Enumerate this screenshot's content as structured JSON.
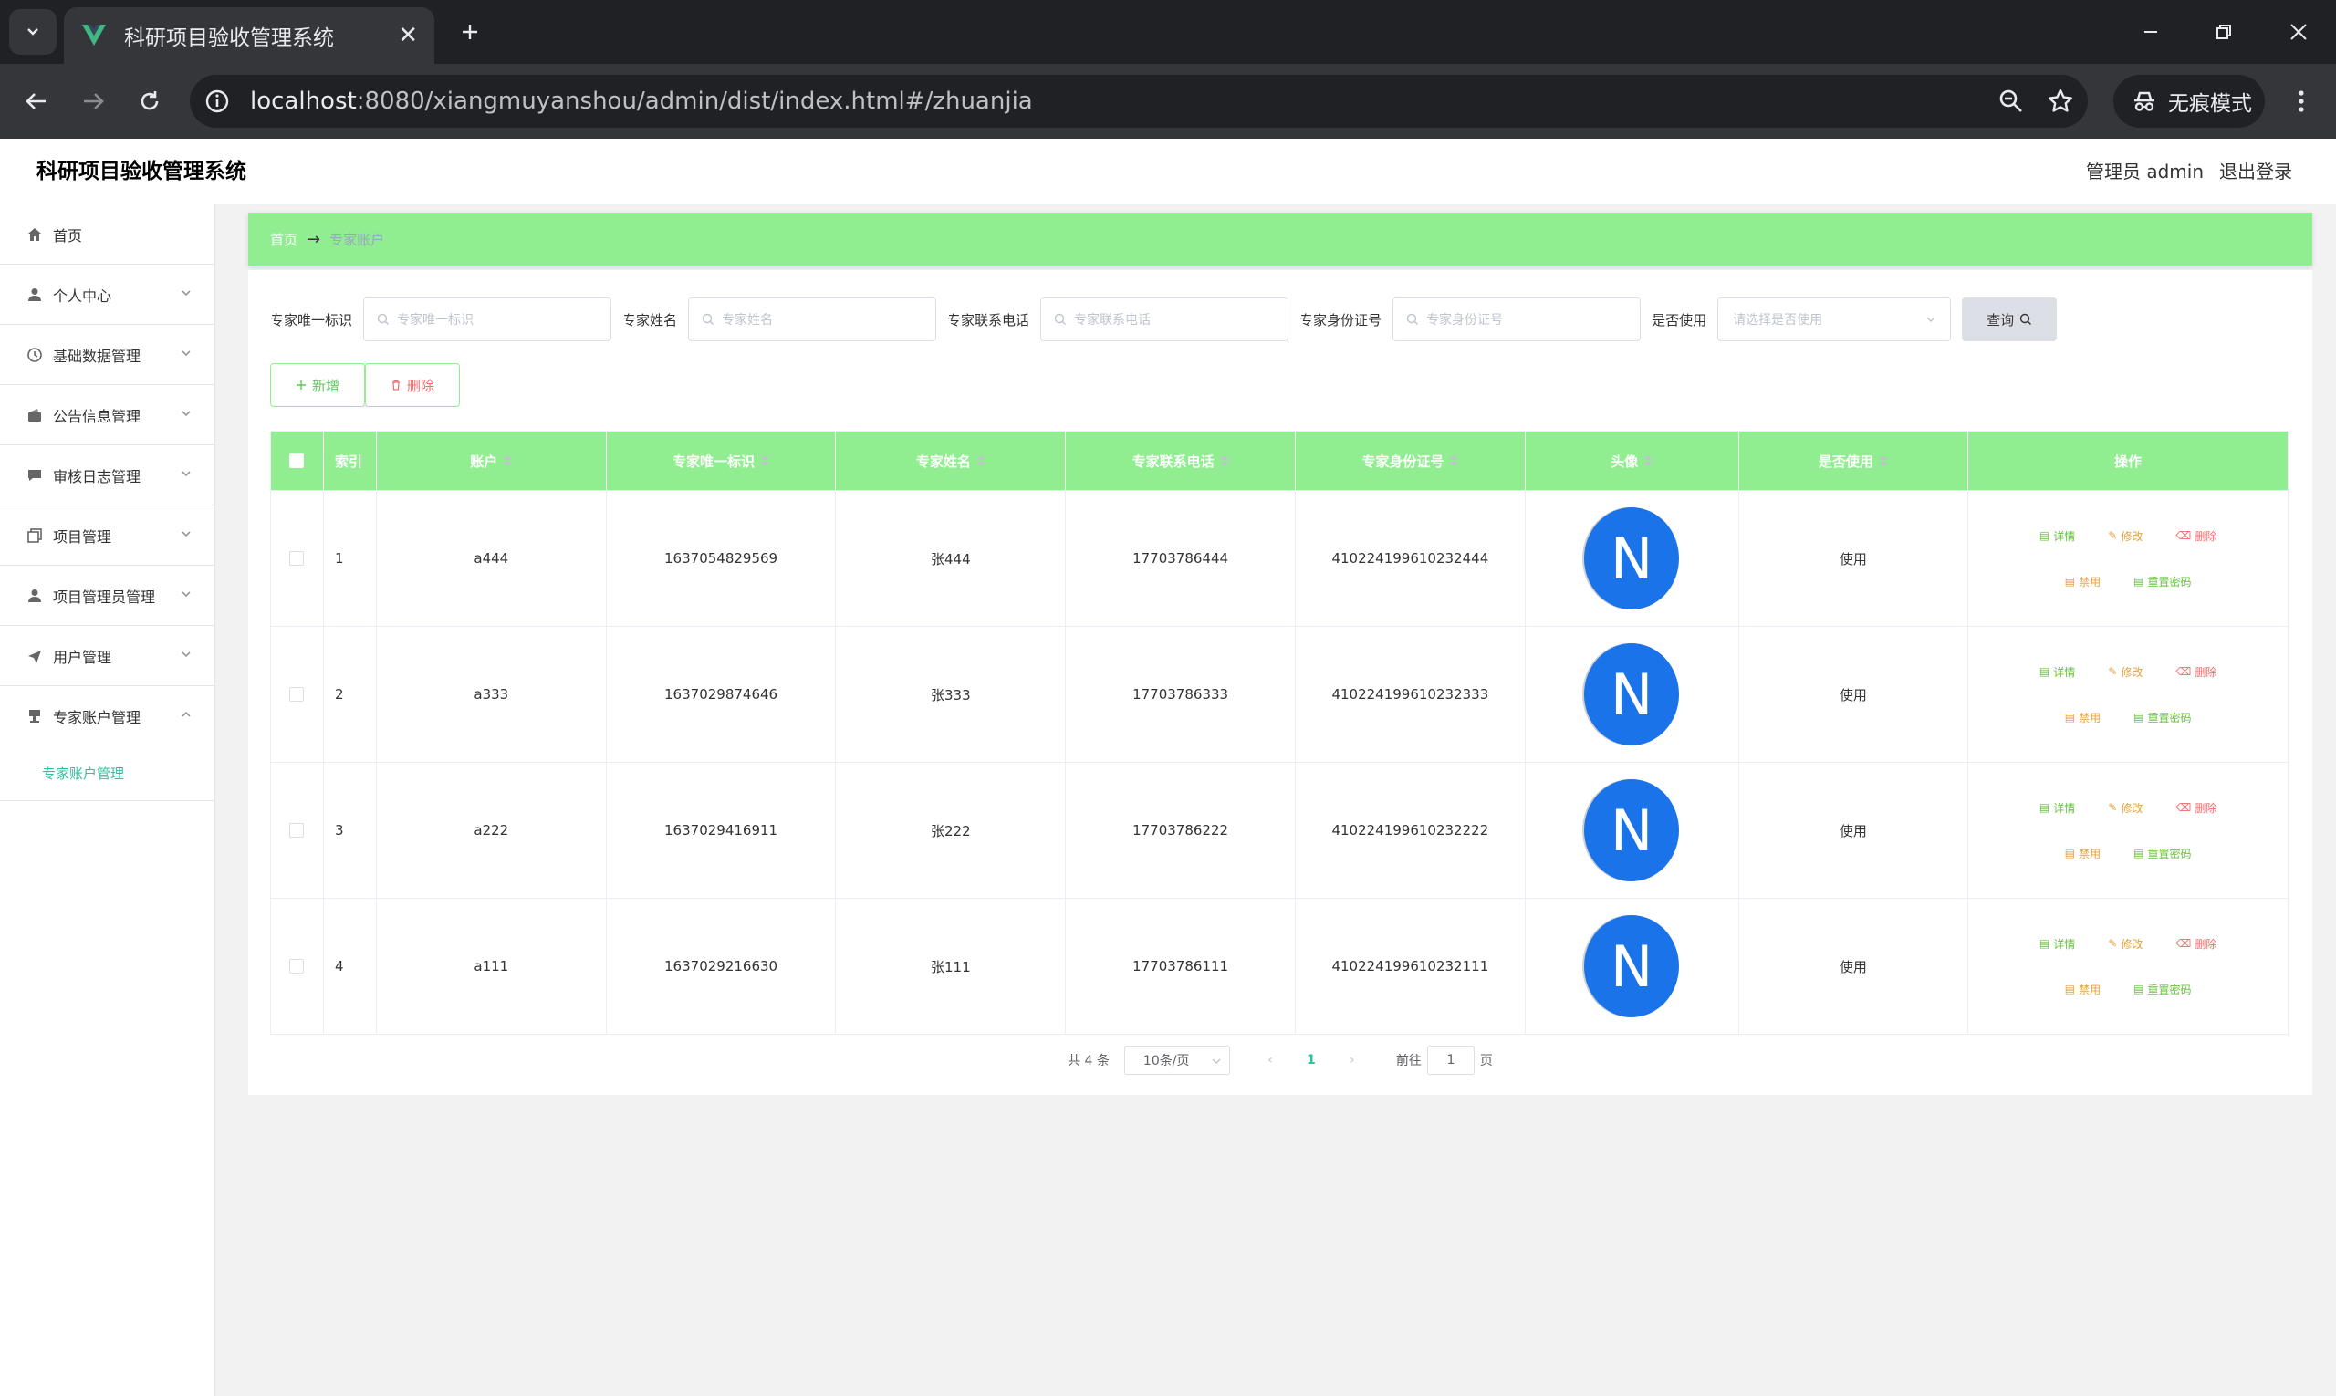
{
  "browser": {
    "tab_title": "科研项目验收管理系统",
    "url_host": "localhost",
    "url_rest": ":8080/xiangmuyanshou/admin/dist/index.html#/zhuanjia",
    "incognito_label": "无痕模式"
  },
  "header": {
    "title": "科研项目验收管理系统",
    "user": "管理员 admin",
    "logout": "退出登录"
  },
  "sidebar": {
    "items": [
      {
        "label": "首页",
        "icon": "home-icon"
      },
      {
        "label": "个人中心",
        "icon": "user-icon"
      },
      {
        "label": "基础数据管理",
        "icon": "clock-icon"
      },
      {
        "label": "公告信息管理",
        "icon": "wallet-icon"
      },
      {
        "label": "审核日志管理",
        "icon": "chat-icon"
      },
      {
        "label": "项目管理",
        "icon": "copy-icon"
      },
      {
        "label": "项目管理员管理",
        "icon": "user-icon"
      },
      {
        "label": "用户管理",
        "icon": "send-icon"
      },
      {
        "label": "专家账户管理",
        "icon": "stamp-icon"
      }
    ],
    "sub_item": "专家账户管理"
  },
  "breadcrumb": {
    "home": "首页",
    "separator": "→",
    "current": "专家账户"
  },
  "search": {
    "fields": [
      {
        "label": "专家唯一标识",
        "placeholder": "专家唯一标识"
      },
      {
        "label": "专家姓名",
        "placeholder": "专家姓名"
      },
      {
        "label": "专家联系电话",
        "placeholder": "专家联系电话"
      },
      {
        "label": "专家身份证号",
        "placeholder": "专家身份证号"
      }
    ],
    "select_label": "是否使用",
    "select_placeholder": "请选择是否使用",
    "query_label": "查询"
  },
  "actions": {
    "add_label": "新增",
    "delete_label": "删除"
  },
  "table": {
    "columns": [
      "索引",
      "账户",
      "专家唯一标识",
      "专家姓名",
      "专家联系电话",
      "专家身份证号",
      "头像",
      "是否使用",
      "操作"
    ],
    "rows": [
      {
        "index": "1",
        "account": "a444",
        "uid": "1637054829569",
        "name": "张444",
        "phone": "17703786444",
        "idcard": "410224199610232444",
        "avatar": "N",
        "status": "使用"
      },
      {
        "index": "2",
        "account": "a333",
        "uid": "1637029874646",
        "name": "张333",
        "phone": "17703786333",
        "idcard": "410224199610232333",
        "avatar": "N",
        "status": "使用"
      },
      {
        "index": "3",
        "account": "a222",
        "uid": "1637029416911",
        "name": "张222",
        "phone": "17703786222",
        "idcard": "410224199610232222",
        "avatar": "N",
        "status": "使用"
      },
      {
        "index": "4",
        "account": "a111",
        "uid": "1637029216630",
        "name": "张111",
        "phone": "17703786111",
        "idcard": "410224199610232111",
        "avatar": "N",
        "status": "使用"
      }
    ],
    "ops": {
      "detail": "详情",
      "edit": "修改",
      "delete": "删除",
      "disable": "禁用",
      "reset": "重置密码"
    }
  },
  "pager": {
    "total": "共 4 条",
    "page_size": "10条/页",
    "current": "1",
    "goto": "前往",
    "goto_value": "1",
    "page_unit": "页"
  },
  "colors": {
    "accent_green": "#90ee90",
    "teal": "#2ec1a0",
    "avatar_blue": "#1a73e8"
  }
}
